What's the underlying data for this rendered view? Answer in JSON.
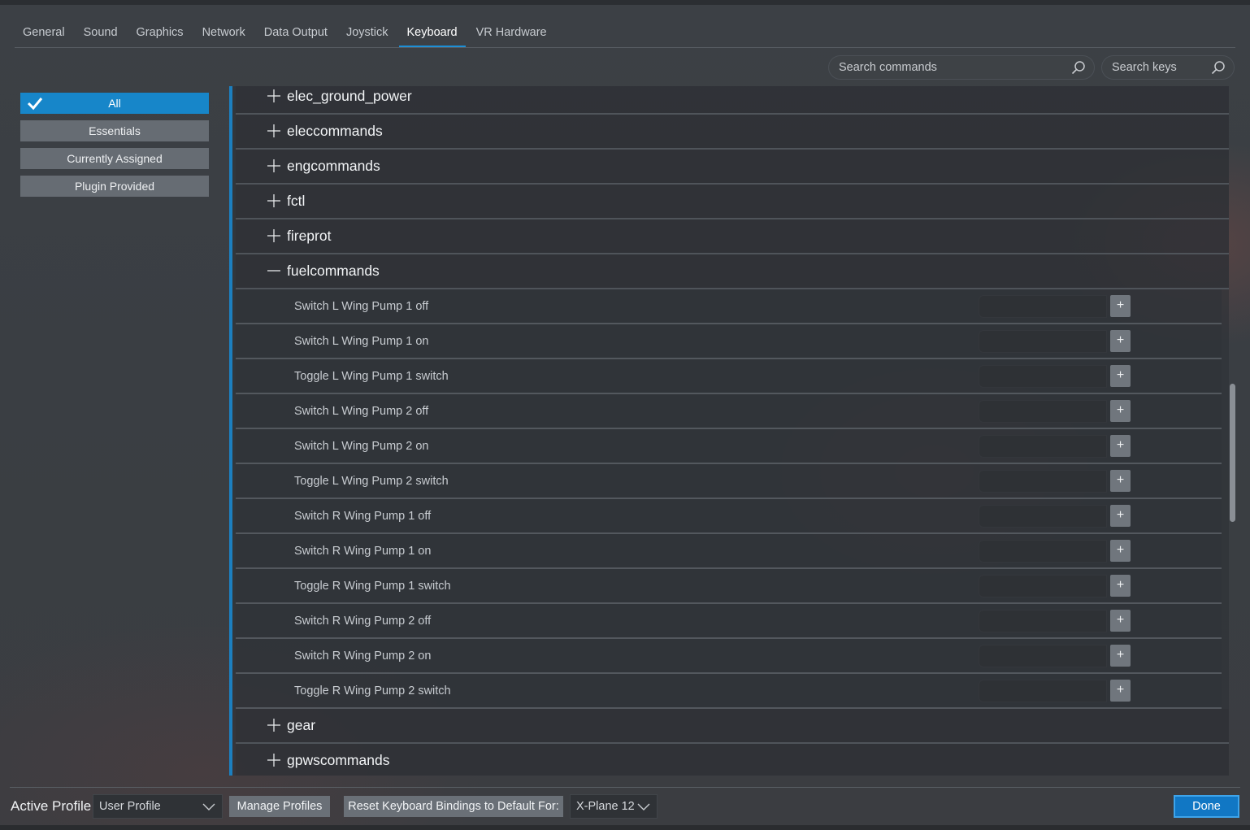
{
  "tabs": [
    {
      "label": "General"
    },
    {
      "label": "Sound"
    },
    {
      "label": "Graphics"
    },
    {
      "label": "Network"
    },
    {
      "label": "Data Output"
    },
    {
      "label": "Joystick"
    },
    {
      "label": "Keyboard",
      "active": true
    },
    {
      "label": "VR Hardware"
    }
  ],
  "search": {
    "commands_placeholder": "Search commands",
    "keys_placeholder": "Search keys",
    "icon": "search-icon"
  },
  "filters": [
    {
      "label": "All",
      "active": true,
      "icon": "check-icon"
    },
    {
      "label": "Essentials"
    },
    {
      "label": "Currently Assigned"
    },
    {
      "label": "Plugin Provided"
    }
  ],
  "groups_before": [
    {
      "name": "elec_ground_power",
      "expanded": false
    },
    {
      "name": "eleccommands",
      "expanded": false
    },
    {
      "name": "engcommands",
      "expanded": false
    },
    {
      "name": "fctl",
      "expanded": false
    },
    {
      "name": "fireprot",
      "expanded": false
    }
  ],
  "expanded_group": {
    "name": "fuelcommands",
    "expanded": true,
    "commands": [
      {
        "label": "Switch L Wing Pump 1 off",
        "key": ""
      },
      {
        "label": "Switch L Wing Pump 1 on",
        "key": ""
      },
      {
        "label": "Toggle L Wing Pump 1 switch",
        "key": ""
      },
      {
        "label": "Switch L Wing Pump 2 off",
        "key": ""
      },
      {
        "label": "Switch L Wing Pump 2 on",
        "key": ""
      },
      {
        "label": "Toggle L Wing Pump 2 switch",
        "key": ""
      },
      {
        "label": "Switch R Wing Pump 1 off",
        "key": ""
      },
      {
        "label": "Switch R Wing Pump 1 on",
        "key": ""
      },
      {
        "label": "Toggle R Wing Pump 1 switch",
        "key": ""
      },
      {
        "label": "Switch R Wing Pump 2 off",
        "key": ""
      },
      {
        "label": "Switch R Wing Pump 2 on",
        "key": ""
      },
      {
        "label": "Toggle R Wing Pump 2 switch",
        "key": ""
      }
    ],
    "add_label": "+"
  },
  "groups_after": [
    {
      "name": "gear",
      "expanded": false
    },
    {
      "name": "gpwscommands",
      "expanded": false
    }
  ],
  "bottom": {
    "active_profile_label": "Active Profile",
    "profile_value": "User Profile",
    "manage_profiles": "Manage Profiles",
    "reset_label": "Reset Keyboard Bindings to Default For:",
    "reset_target": "X-Plane 12",
    "done": "Done"
  },
  "colors": {
    "accent": "#1786c9",
    "accent_underline": "#1d8fd6",
    "done_border": "#3ea4ea"
  }
}
